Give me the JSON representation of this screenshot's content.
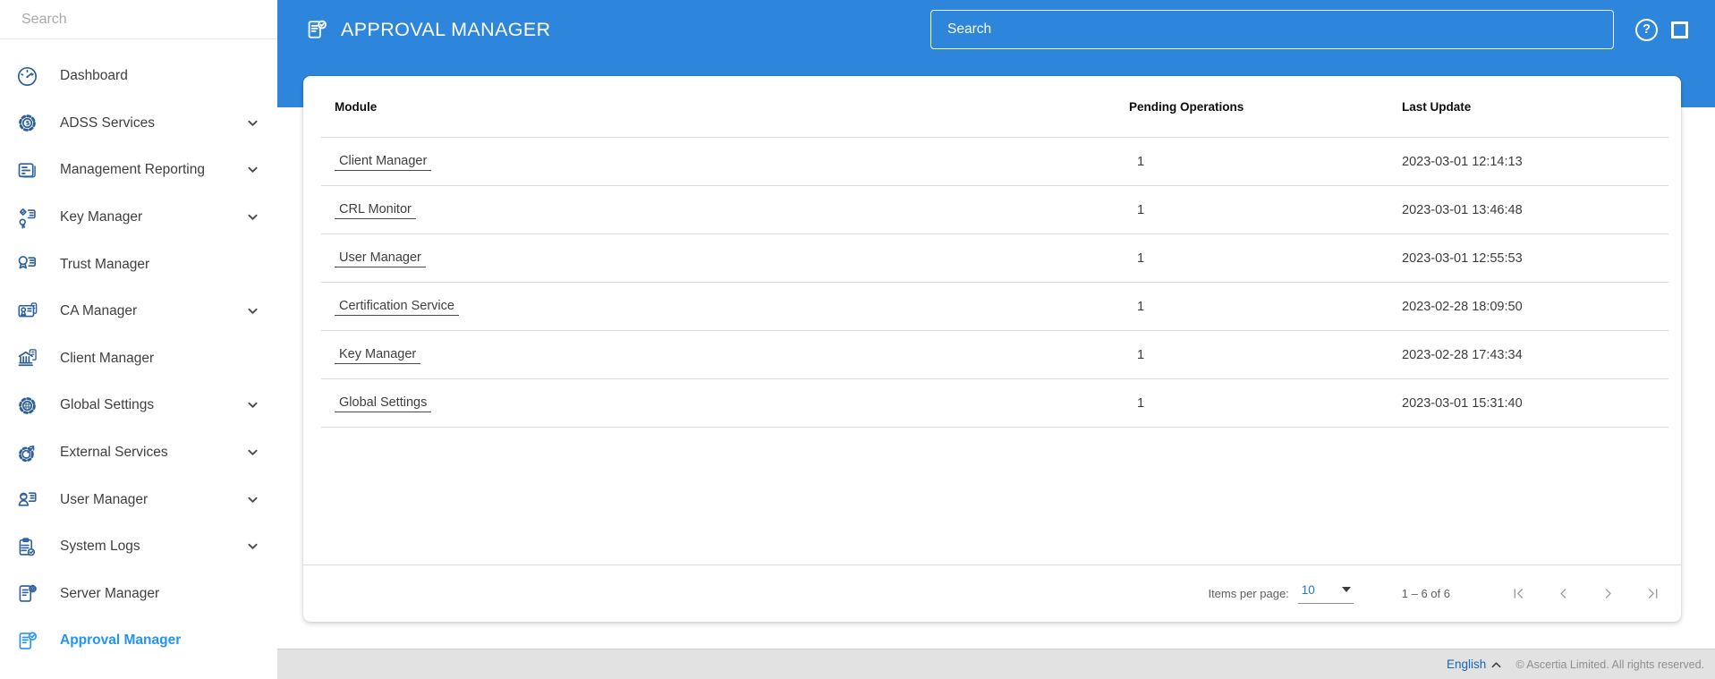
{
  "sidebar": {
    "search_placeholder": "Search",
    "items": [
      {
        "label": "Dashboard",
        "icon": "dashboard-icon",
        "expandable": false,
        "active": false
      },
      {
        "label": "ADSS Services",
        "icon": "adss-services-gear-icon",
        "expandable": true,
        "active": false
      },
      {
        "label": "Management Reporting",
        "icon": "management-reporting-icon",
        "expandable": true,
        "active": false
      },
      {
        "label": "Key Manager",
        "icon": "key-manager-icon",
        "expandable": true,
        "active": false
      },
      {
        "label": "Trust Manager",
        "icon": "trust-manager-icon",
        "expandable": false,
        "active": false
      },
      {
        "label": "CA Manager",
        "icon": "ca-manager-icon",
        "expandable": true,
        "active": false
      },
      {
        "label": "Client Manager",
        "icon": "client-manager-icon",
        "expandable": false,
        "active": false
      },
      {
        "label": "Global Settings",
        "icon": "global-settings-icon",
        "expandable": true,
        "active": false
      },
      {
        "label": "External Services",
        "icon": "external-services-icon",
        "expandable": true,
        "active": false
      },
      {
        "label": "User Manager",
        "icon": "user-manager-icon",
        "expandable": true,
        "active": false
      },
      {
        "label": "System Logs",
        "icon": "system-logs-icon",
        "expandable": true,
        "active": false
      },
      {
        "label": "Server Manager",
        "icon": "server-manager-icon",
        "expandable": false,
        "active": false
      },
      {
        "label": "Approval Manager",
        "icon": "approval-manager-icon",
        "expandable": false,
        "active": true
      }
    ]
  },
  "header": {
    "title": "APPROVAL MANAGER",
    "title_icon": "approval-manager-icon",
    "search_placeholder": "Search",
    "help_glyph": "?"
  },
  "table": {
    "columns": [
      "Module",
      "Pending Operations",
      "Last Update"
    ],
    "rows": [
      {
        "module": "Client Manager",
        "pending": "1",
        "last_update": "2023-03-01 12:14:13"
      },
      {
        "module": "CRL Monitor",
        "pending": "1",
        "last_update": "2023-03-01 13:46:48"
      },
      {
        "module": "User Manager",
        "pending": "1",
        "last_update": "2023-03-01 12:55:53"
      },
      {
        "module": "Certification Service",
        "pending": "1",
        "last_update": "2023-02-28 18:09:50"
      },
      {
        "module": "Key Manager",
        "pending": "1",
        "last_update": "2023-02-28 17:43:34"
      },
      {
        "module": "Global Settings",
        "pending": "1",
        "last_update": "2023-03-01 15:31:40"
      }
    ]
  },
  "pagination": {
    "items_per_page_label": "Items per page:",
    "items_per_page_value": "10",
    "range_label": "1 – 6 of 6",
    "controls": [
      "first-page-icon",
      "previous-page-icon",
      "next-page-icon",
      "last-page-icon"
    ]
  },
  "footer": {
    "language": "English",
    "copyright": "© Ascertia Limited. All rights reserved."
  },
  "colors": {
    "header_blue": "#2e86dc",
    "sidebar_icon_blue": "#2d5f9a",
    "active_item_blue": "#2494f4",
    "items_per_page_value_blue": "#2076cd",
    "footer_language_blue": "#1766b8"
  }
}
